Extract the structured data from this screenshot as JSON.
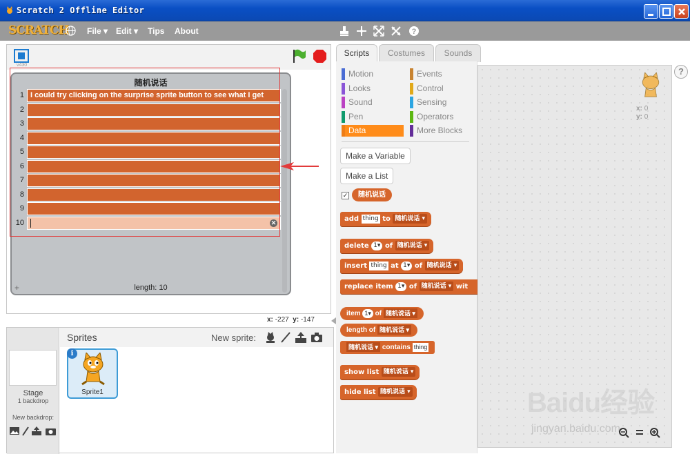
{
  "window": {
    "title": "Scratch 2 Offline Editor"
  },
  "menubar": {
    "logo": "SCRATCH",
    "items": [
      "File ▾",
      "Edit ▾",
      "Tips",
      "About"
    ]
  },
  "stage": {
    "version": "v430",
    "coords": {
      "x_label": "x:",
      "x": "-227",
      "y_label": "y:",
      "y": "-147"
    }
  },
  "list_monitor": {
    "title": "随机说话",
    "rows": [
      {
        "index": "1",
        "value": "I could try clicking on the surprise sprite button to see what I get"
      },
      {
        "index": "2",
        "value": ""
      },
      {
        "index": "3",
        "value": ""
      },
      {
        "index": "4",
        "value": ""
      },
      {
        "index": "5",
        "value": ""
      },
      {
        "index": "6",
        "value": ""
      },
      {
        "index": "7",
        "value": ""
      },
      {
        "index": "8",
        "value": ""
      },
      {
        "index": "9",
        "value": ""
      },
      {
        "index": "10",
        "value": ""
      }
    ],
    "add_symbol": "+",
    "length_text": "length: 10"
  },
  "sprite_pane": {
    "stage_label": "Stage",
    "backdrop_count": "1 backdrop",
    "new_backdrop": "New backdrop:",
    "sprites_title": "Sprites",
    "new_sprite": "New sprite:",
    "sprite_name": "Sprite1",
    "info_symbol": "i"
  },
  "tabs": [
    "Scripts",
    "Costumes",
    "Sounds"
  ],
  "categories": [
    {
      "label": "Motion",
      "color": "#4a6cd4"
    },
    {
      "label": "Events",
      "color": "#c88330"
    },
    {
      "label": "Looks",
      "color": "#8a55d7"
    },
    {
      "label": "Control",
      "color": "#e1a91a"
    },
    {
      "label": "Sound",
      "color": "#bb42c3"
    },
    {
      "label": "Sensing",
      "color": "#2ca5e2"
    },
    {
      "label": "Pen",
      "color": "#0e9a6c"
    },
    {
      "label": "Operators",
      "color": "#5cb712"
    },
    {
      "label": "Data",
      "color": "#ee7d16"
    },
    {
      "label": "More Blocks",
      "color": "#632d99"
    }
  ],
  "palette": {
    "make_variable": "Make a Variable",
    "make_list": "Make a List",
    "list_reporter": "随机说话",
    "check_mark": "✓",
    "blocks": {
      "add": {
        "w1": "add",
        "thing": "thing",
        "w2": "to",
        "list": "随机说话 ▾"
      },
      "delete": {
        "w1": "delete",
        "num": "1▾",
        "w2": "of",
        "list": "随机说话 ▾"
      },
      "insert": {
        "w1": "insert",
        "thing": "thing",
        "w2": "at",
        "num": "1▾",
        "w3": "of",
        "list": "随机说话 ▾"
      },
      "replace": {
        "w1": "replace item",
        "num": "1▾",
        "w2": "of",
        "list": "随机说话 ▾",
        "w3": "wit"
      },
      "item": {
        "w1": "item",
        "num": "1▾",
        "w2": "of",
        "list": "随机说话 ▾"
      },
      "length": {
        "w1": "length of",
        "list": "随机说话 ▾"
      },
      "contains": {
        "list": "随机说话 ▾",
        "w1": "contains",
        "thing": "thing"
      },
      "show": {
        "w1": "show list",
        "list": "随机说话 ▾"
      },
      "hide": {
        "w1": "hide list",
        "list": "随机说话 ▾"
      }
    }
  },
  "scripts_area": {
    "x_label": "x:",
    "x": "0",
    "y_label": "y:",
    "y": "0",
    "help": "?"
  },
  "watermark": {
    "main": "Baidu经验",
    "sub": "jingyan.baidu.com"
  },
  "colors": {
    "data_block": "#d6652b",
    "title_bar": "#0a4fc4",
    "menu_bar": "#9a9a9a",
    "annotation": "#e23b3b"
  }
}
